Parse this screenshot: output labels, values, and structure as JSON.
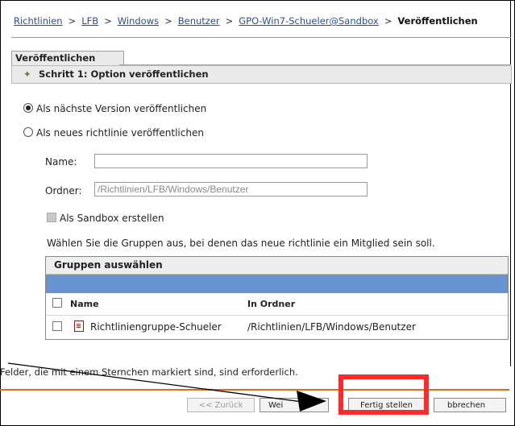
{
  "breadcrumb": {
    "items": [
      "Richtlinien",
      "LFB",
      "Windows",
      "Benutzer",
      "GPO-Win7-Schueler@Sandbox"
    ],
    "separator": ">",
    "current": "Veröffentlichen"
  },
  "tab": {
    "label": "Veröffentlichen"
  },
  "step": {
    "title": "Schritt 1: Option veröffentlichen"
  },
  "options": {
    "next_version": "Als nächste Version veröffentlichen",
    "new_policy": "Als neues richtlinie veröffentlichen",
    "selected": "next_version"
  },
  "form": {
    "name_label": "Name:",
    "name_value": "",
    "folder_label": "Ordner:",
    "folder_value": "/Richtlinien/LFB/Windows/Benutzer",
    "sandbox_label": "Als Sandbox erstellen"
  },
  "groups": {
    "instruction": "Wählen Sie die Gruppen aus, bei denen das neue richtlinie ein Mitglied sein soll.",
    "title": "Gruppen auswählen",
    "columns": [
      "Name",
      "In Ordner"
    ],
    "rows": [
      {
        "name": "Richtliniengruppe-Schueler",
        "folder": "/Richtlinien/LFB/Windows/Benutzer"
      }
    ]
  },
  "footer": {
    "required_note": "Felder, die mit einem Sternchen markiert sind, sind erforderlich."
  },
  "buttons": {
    "back": "<< Zurück",
    "next": "Wei",
    "finish": "Fertig stellen",
    "cancel": "bbrechen"
  },
  "colors": {
    "accent_blue": "#6893d1",
    "footer_line": "#e06a1a",
    "highlight": "#ff2a2a",
    "link": "#2a4e9c"
  }
}
